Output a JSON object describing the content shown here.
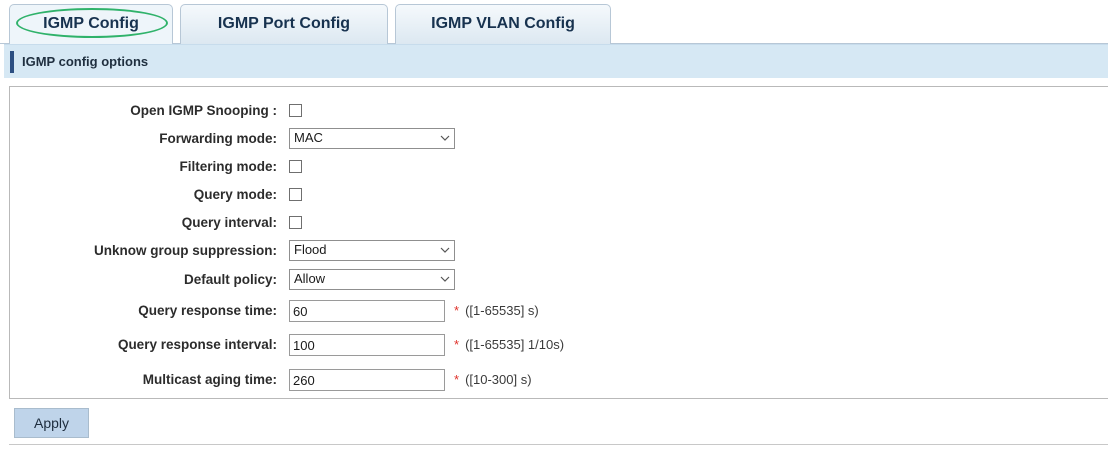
{
  "tabs": [
    {
      "label": "IGMP Config",
      "active": true
    },
    {
      "label": "IGMP Port Config",
      "active": false
    },
    {
      "label": "IGMP VLAN Config",
      "active": false
    }
  ],
  "section": {
    "title": "IGMP config options"
  },
  "form": {
    "open_igmp_snooping": {
      "label": "Open IGMP Snooping :",
      "checked": false
    },
    "forwarding_mode": {
      "label": "Forwarding mode:",
      "value": "MAC"
    },
    "filtering_mode": {
      "label": "Filtering mode:",
      "checked": false
    },
    "query_mode": {
      "label": "Query mode:",
      "checked": false
    },
    "query_interval": {
      "label": "Query interval:",
      "checked": false
    },
    "unknow_group_suppression": {
      "label": "Unknow group suppression:",
      "value": "Flood"
    },
    "default_policy": {
      "label": "Default policy:",
      "value": "Allow"
    },
    "query_response_time": {
      "label": "Query response time:",
      "value": "60",
      "required": "*",
      "hint": "([1-65535] s)"
    },
    "query_response_interval": {
      "label": "Query response interval:",
      "value": "100",
      "required": "*",
      "hint": "([1-65535] 1/10s)"
    },
    "multicast_aging_time": {
      "label": "Multicast aging time:",
      "value": "260",
      "required": "*",
      "hint": "([10-300] s)"
    }
  },
  "buttons": {
    "apply_label": "Apply"
  },
  "colors": {
    "tab_highlight": "#2fb26a",
    "header_bg": "#d6e8f4",
    "header_accent": "#2c4f82",
    "required_star": "#e0312a",
    "apply_bg": "#bfd4ea"
  },
  "icons": {
    "select_arrow": "chevron-down-icon"
  }
}
